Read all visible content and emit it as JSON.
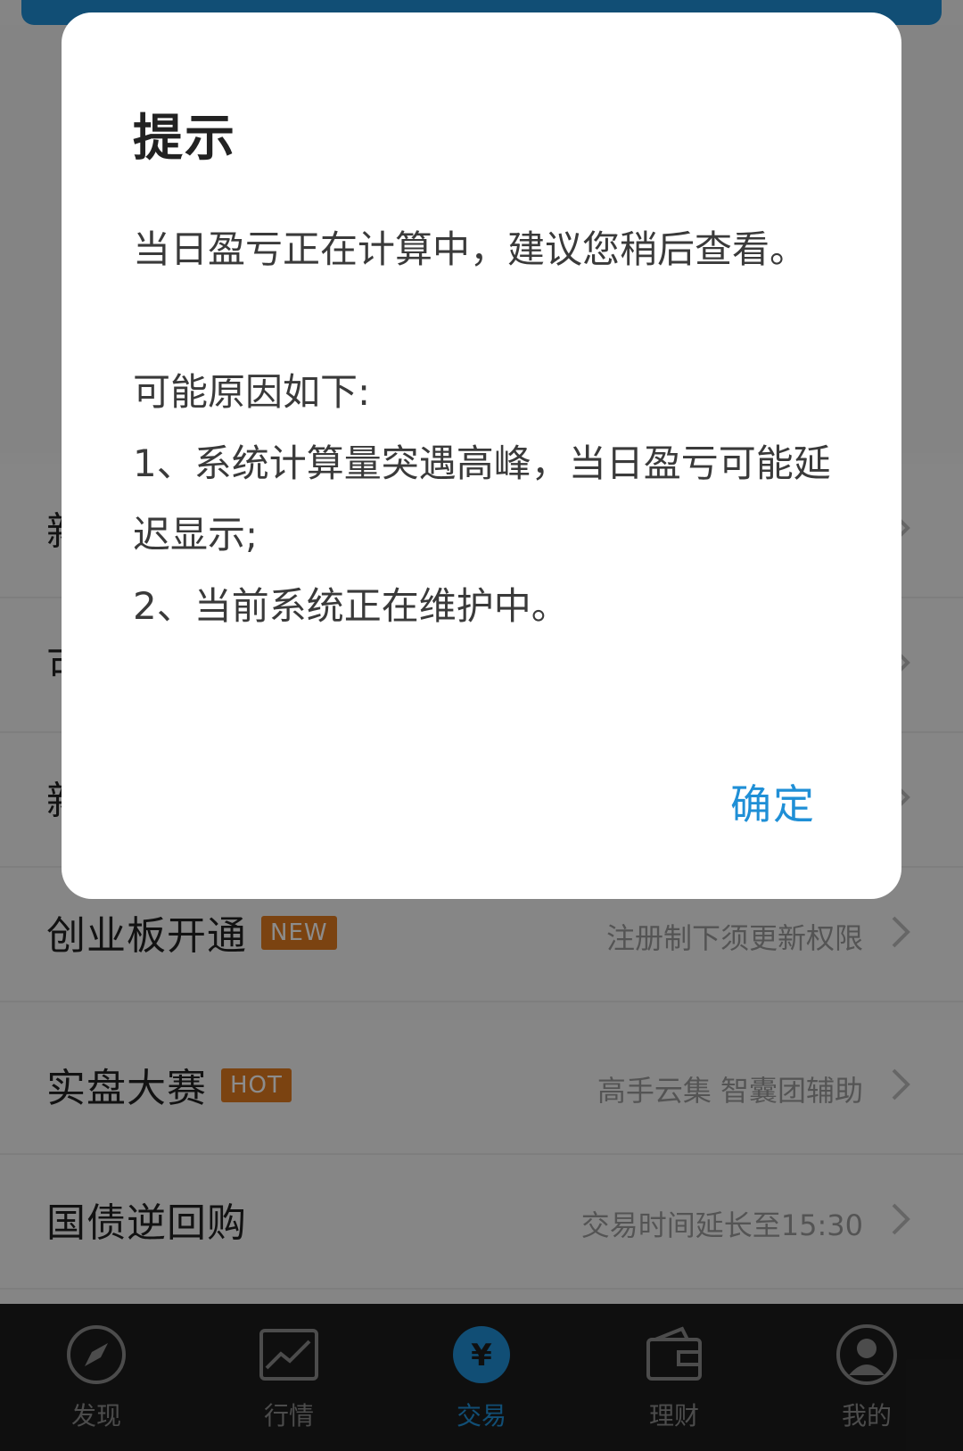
{
  "dialog": {
    "title": "提示",
    "message_1": "当日盈亏正在计算中，建议您稍后查看。",
    "reasons_header": "可能原因如下:",
    "reason_1": "1、系统计算量突遇高峰，当日盈亏可能延迟显示;",
    "reason_2": "2、当前系统正在维护中。",
    "confirm_label": "确定"
  },
  "list": {
    "items": [
      {
        "title": "新",
        "subtitle": ""
      },
      {
        "title": "可",
        "subtitle": ""
      },
      {
        "title": "新",
        "subtitle": ""
      },
      {
        "title": "创业板开通",
        "badge": "NEW",
        "subtitle": "注册制下须更新权限"
      },
      {
        "title": "实盘大赛",
        "badge": "HOT",
        "subtitle": "高手云集 智囊团辅助"
      },
      {
        "title": "国债逆回购",
        "subtitle": "交易时间延长至15:30"
      }
    ]
  },
  "tabbar": {
    "tabs": [
      {
        "label": "发现",
        "icon": "compass-icon"
      },
      {
        "label": "行情",
        "icon": "chart-icon"
      },
      {
        "label": "交易",
        "icon": "yen-icon",
        "active": true
      },
      {
        "label": "理财",
        "icon": "wallet-icon"
      },
      {
        "label": "我的",
        "icon": "user-icon"
      }
    ]
  },
  "colors": {
    "accent": "#1f8fd6",
    "badge": "#e07a1f"
  }
}
